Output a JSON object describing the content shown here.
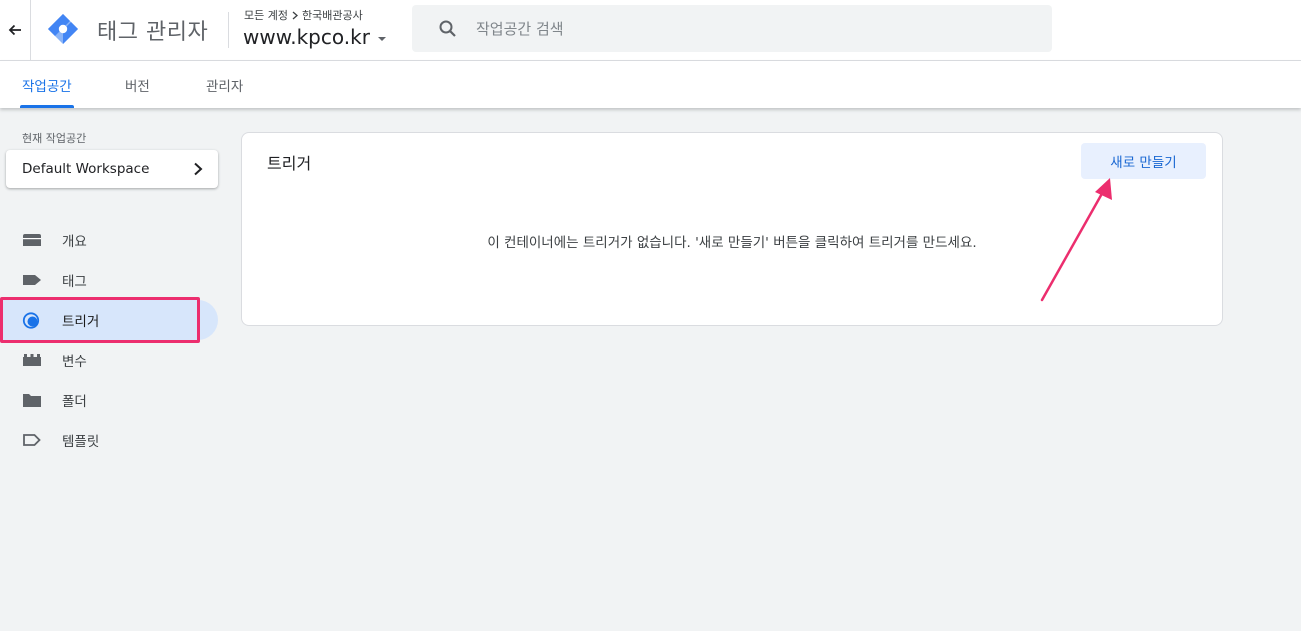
{
  "header": {
    "app_title": "태그 관리자",
    "account_crumb": "모든 계정",
    "account_name": "한국배관공사",
    "container": "www.kpco.kr",
    "search_placeholder": "작업공간 검색"
  },
  "tabs": [
    {
      "label": "작업공간",
      "active": true
    },
    {
      "label": "버전",
      "active": false
    },
    {
      "label": "관리자",
      "active": false
    }
  ],
  "sidebar": {
    "workspace_label": "현재 작업공간",
    "workspace_name": "Default Workspace",
    "items": [
      {
        "label": "개요",
        "icon": "briefcase-icon"
      },
      {
        "label": "태그",
        "icon": "tag-icon"
      },
      {
        "label": "트리거",
        "icon": "trigger-icon",
        "active": true
      },
      {
        "label": "변수",
        "icon": "variable-icon"
      },
      {
        "label": "폴더",
        "icon": "folder-icon"
      },
      {
        "label": "템플릿",
        "icon": "template-icon"
      }
    ]
  },
  "main": {
    "title": "트리거",
    "new_button": "새로 만들기",
    "empty_message": "이 컨테이너에는 트리거가 없습니다. '새로 만들기' 버튼을 클릭하여 트리거를 만드세요."
  },
  "colors": {
    "accent": "#1a73e8",
    "annotation": "#ec2e6e",
    "active_nav_bg": "#d7e6fb"
  }
}
